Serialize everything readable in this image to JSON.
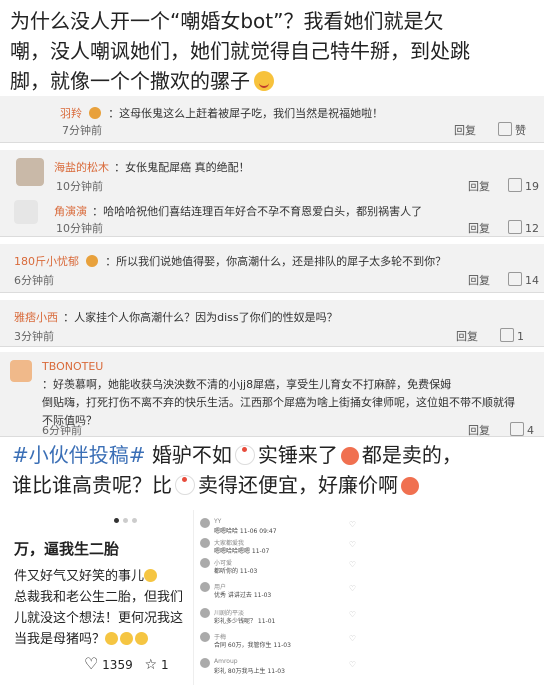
{
  "headline": {
    "line1": "为什么没人开一个“嘲婚女bot”？我看她们就是欠",
    "line2": "嘲，没人嘲讽她们，她们就觉得自己特牛掰，到处跳",
    "line3": "脚，就像一个个撒欢的骡子"
  },
  "comments": [
    {
      "name": "羽羚",
      "text": "：这母伥鬼这么上赶着被犀子吃，我们当然是祝福她啦！",
      "time": "7分钟前",
      "reply": "回复",
      "like": "赞"
    },
    {
      "name": "海盐的松木",
      "text": "：女伥鬼配犀癌 真的绝配！",
      "time": "10分钟前",
      "reply": "回复",
      "likes": "19"
    },
    {
      "name": "角演演",
      "text": "：哈哈哈祝他们喜结连理百年好合不孕不育恩爱白头，都别祸害人了",
      "time": "10分钟前",
      "reply": "回复",
      "likes": "12"
    },
    {
      "name": "180斤小忧郁",
      "text": "：所以我们说她值得娶，你高潮什么，还是排队的犀子太多轮不到你？",
      "time": "6分钟前",
      "reply": "回复",
      "likes": "14"
    },
    {
      "name": "雅痞小西",
      "text": "：人家挂个人你高潮什么？因为diss了你们的性奴是吗？",
      "time": "3分钟前",
      "reply": "回复",
      "likes": "1"
    },
    {
      "name": "TBONOTEU",
      "text1": "：好羡慕啊，她能收获乌泱泱数不清的小jj8犀癌，享受生儿育女不打麻醉，免费保姆",
      "text2": "倒贴嗨，打死打伤不离不弃的快乐生活。江西那个犀癌为啥上街捅女律师呢，这位姐不带不顺就得",
      "text3": "不际值吗？",
      "time": "6分钟前",
      "reply": "回复",
      "likes": "4"
    }
  ],
  "tagline": {
    "hashtag": "#小伙伴投稿#",
    "part1": " 婚驴不如",
    "part2": "实锤来了",
    "part3": "都是卖的，",
    "line2a": "谁比谁高贵呢？比",
    "line2b": "卖得还便宜，好廉价啊"
  },
  "post": {
    "title": "万，逼我生二胎",
    "l1": "件又好气又好笑的事儿",
    "l2": "总裁我和老公生二胎，但我们",
    "l3": "儿就没这个想法！更何况我这",
    "l4": "当我是母猪吗？",
    "likes": "1359",
    "shares": "1"
  },
  "thread": [
    {
      "name": "YY",
      "text": "嗯嗯哈哈 11-06 09:47"
    },
    {
      "name": "大家都爱我",
      "text": "嗯嗯哈哈嗯嗯 11-07"
    },
    {
      "name": "小可爱",
      "text": "都听你的 11-03"
    },
    {
      "name": "用户",
      "text": "优秀 讲讲过去 11-03"
    },
    {
      "name": "川剧的平淡",
      "text": "彩礼多少钱呢？ 11-01"
    },
    {
      "name": "于梅",
      "text": "合同 60万，我管你生 11-03"
    },
    {
      "name": "Amroup",
      "text": "彩礼 80万我马上生 11-03"
    }
  ]
}
